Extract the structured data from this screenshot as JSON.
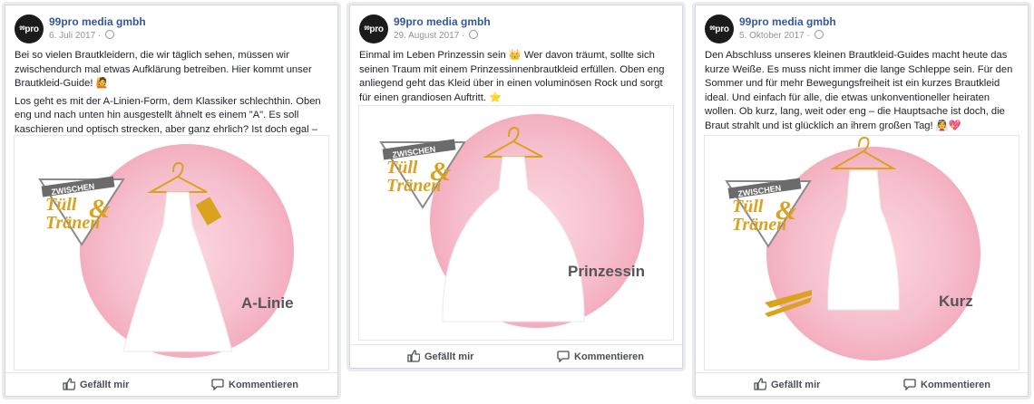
{
  "posts": [
    {
      "author": "99pro media gmbh",
      "avatar_text": "pro",
      "avatar_sup": "99",
      "date": "6. Juli 2017 · ",
      "paragraphs": [
        "Bei so vielen Brautkleidern, die wir täglich sehen, müssen wir zwischendurch mal etwas Aufklärung betreiben. Hier kommt unser Brautkleid-Guide! 🙋",
        "Los geht es mit der A-Linien-Form, dem Klassiker schlechthin. Oben eng und nach unten hin ausgestellt ähnelt es einem \"A\". Es soll kaschieren und optisch strecken, aber ganz ehrlich? Ist doch egal – angezogen wird, was gefällt! 🙂"
      ],
      "image": {
        "logo_top": "ZWISCHEN",
        "logo_line1": "Tüll",
        "logo_amp": "&",
        "logo_line2": "Tränen",
        "caption": "A-Linie"
      },
      "like_label": "Gefällt mir",
      "comment_label": "Kommentieren"
    },
    {
      "author": "99pro media gmbh",
      "avatar_text": "pro",
      "avatar_sup": "99",
      "date": "29. August 2017 · ",
      "paragraphs": [
        "Einmal im Leben Prinzessin sein 👑 Wer davon träumt, sollte sich seinen Traum mit einem Prinzessinnenbrautkleid erfüllen. Oben eng anliegend geht das Kleid über in einen voluminösen Rock und sorgt für einen grandiosen Auftritt. ⭐"
      ],
      "image": {
        "logo_top": "ZWISCHEN",
        "logo_line1": "Tüll",
        "logo_amp": "&",
        "logo_line2": "Tränen",
        "caption": "Prinzessin"
      },
      "like_label": "Gefällt mir",
      "comment_label": "Kommentieren"
    },
    {
      "author": "99pro media gmbh",
      "avatar_text": "pro",
      "avatar_sup": "99",
      "date": "5. Oktober 2017 · ",
      "paragraphs": [
        "Den Abschluss unseres kleinen Brautkleid-Guides macht heute das kurze Weiße. Es muss nicht immer die lange Schleppe sein. Für den Sommer und für mehr Bewegungsfreiheit ist ein kurzes Brautkleid ideal. Und einfach für alle, die etwas unkonventioneller heiraten wollen. Ob kurz, lang, weit oder eng – die Hauptsache ist doch, die Braut strahlt und ist glücklich an ihrem großen Tag! 👰💖"
      ],
      "image": {
        "logo_top": "ZWISCHEN",
        "logo_line1": "Tüll",
        "logo_amp": "&",
        "logo_line2": "Tränen",
        "caption": "Kurz"
      },
      "like_label": "Gefällt mir",
      "comment_label": "Kommentieren"
    }
  ],
  "colors": {
    "link": "#365899",
    "gold": "#d9a21f",
    "pink": "#f5b8c9",
    "meta": "#90949c"
  }
}
